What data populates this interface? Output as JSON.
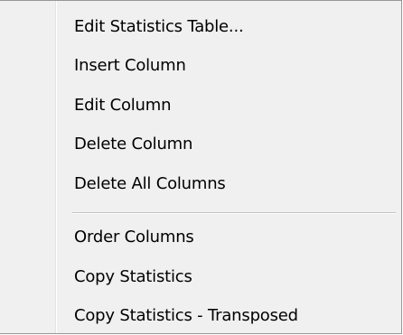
{
  "context_menu": {
    "group_1": [
      {
        "label": "Edit Statistics Table..."
      },
      {
        "label": "Insert Column"
      },
      {
        "label": "Edit Column"
      },
      {
        "label": "Delete Column"
      },
      {
        "label": "Delete All Columns"
      }
    ],
    "group_2": [
      {
        "label": "Order Columns"
      },
      {
        "label": "Copy Statistics"
      },
      {
        "label": "Copy Statistics - Transposed"
      }
    ]
  },
  "colors": {
    "menu_background": "#f0f0f0",
    "menu_border": "#979797",
    "separator": "#c4c4c4",
    "text": "#000000"
  }
}
